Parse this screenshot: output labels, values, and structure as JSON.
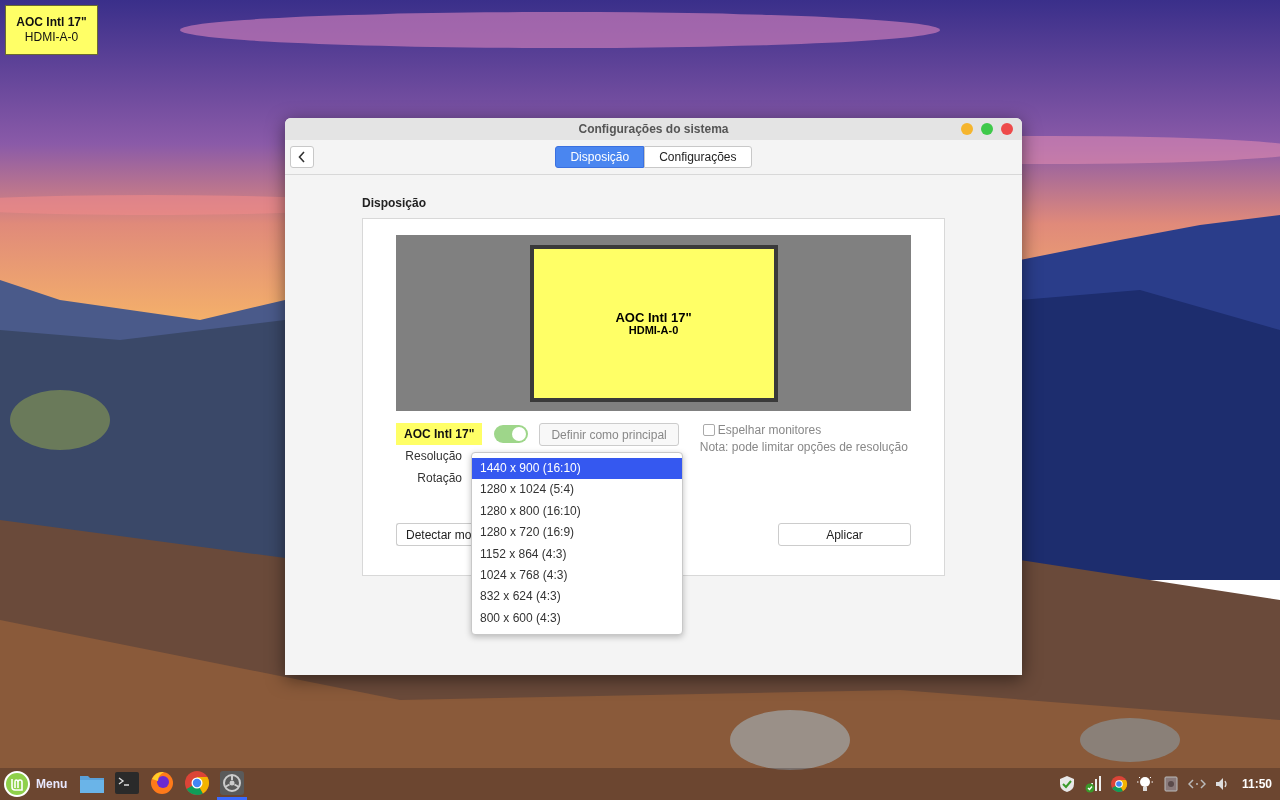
{
  "desktop_label": {
    "name": "AOC Intl 17\"",
    "port": "HDMI-A-0"
  },
  "window": {
    "title": "Configurações do sistema",
    "tabs": [
      {
        "label": "Disposição",
        "selected": true
      },
      {
        "label": "Configurações",
        "selected": false
      }
    ],
    "section_title": "Disposição",
    "monitor_preview": {
      "name": "AOC Intl 17\"",
      "port": "HDMI-A-0"
    },
    "monitor": {
      "name": "AOC Intl 17\"",
      "enabled": true
    },
    "primary_button": {
      "label": "Definir como principal",
      "disabled": true
    },
    "mirror": {
      "label": "Espelhar monitores",
      "checked": false
    },
    "note": "Nota: pode limitar opções de resolução",
    "fields": [
      {
        "label": "Resolução"
      },
      {
        "label": "Rotação"
      }
    ],
    "resolution_options": [
      {
        "label": "1440 x 900 (16:10)",
        "selected": true
      },
      {
        "label": "1280 x 1024 (5:4)",
        "selected": false
      },
      {
        "label": "1280 x 800 (16:10)",
        "selected": false
      },
      {
        "label": "1280 x 720 (16:9)",
        "selected": false
      },
      {
        "label": "1152 x 864 (4:3)",
        "selected": false
      },
      {
        "label": "1024 x 768 (4:3)",
        "selected": false
      },
      {
        "label": "832 x 624 (4:3)",
        "selected": false
      },
      {
        "label": "800 x 600 (4:3)",
        "selected": false
      }
    ],
    "buttons": [
      {
        "label": "Detectar mo"
      },
      {
        "label": "Aplicar"
      }
    ]
  },
  "taskbar": {
    "menu_label": "Menu",
    "launchers": [
      {
        "kind": "folder",
        "active": false
      },
      {
        "kind": "terminal",
        "active": false
      },
      {
        "kind": "firefox",
        "active": false
      },
      {
        "kind": "chrome",
        "active": false
      },
      {
        "kind": "settings",
        "active": true
      }
    ],
    "clock": "11:50"
  }
}
